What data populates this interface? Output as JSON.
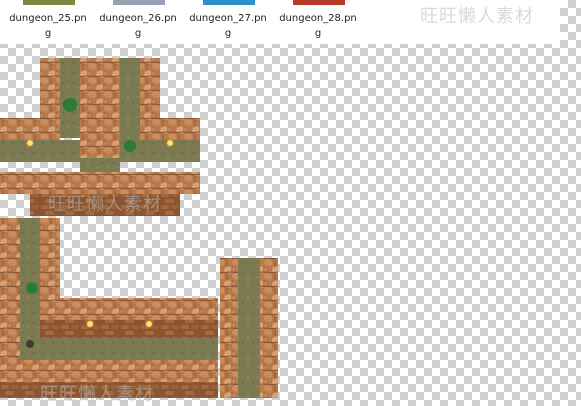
{
  "files": [
    {
      "name": "dungeon_25.png",
      "thumb_color": "#7a8a43"
    },
    {
      "name": "dungeon_26.png",
      "thumb_color": "#9aa0b4"
    },
    {
      "name": "dungeon_27.png",
      "thumb_color": "#2f8fc9"
    },
    {
      "name": "dungeon_28.png",
      "thumb_color": "#b33a2a"
    }
  ],
  "watermark": "旺旺懒人素材",
  "colors": {
    "rock": "#b9794b",
    "rock_dark": "#7a4a2b",
    "rock_light": "#d7a273",
    "floor": "#7b7a52",
    "floor_dark": "#5f5e3c",
    "moss": "#2f7a37"
  }
}
